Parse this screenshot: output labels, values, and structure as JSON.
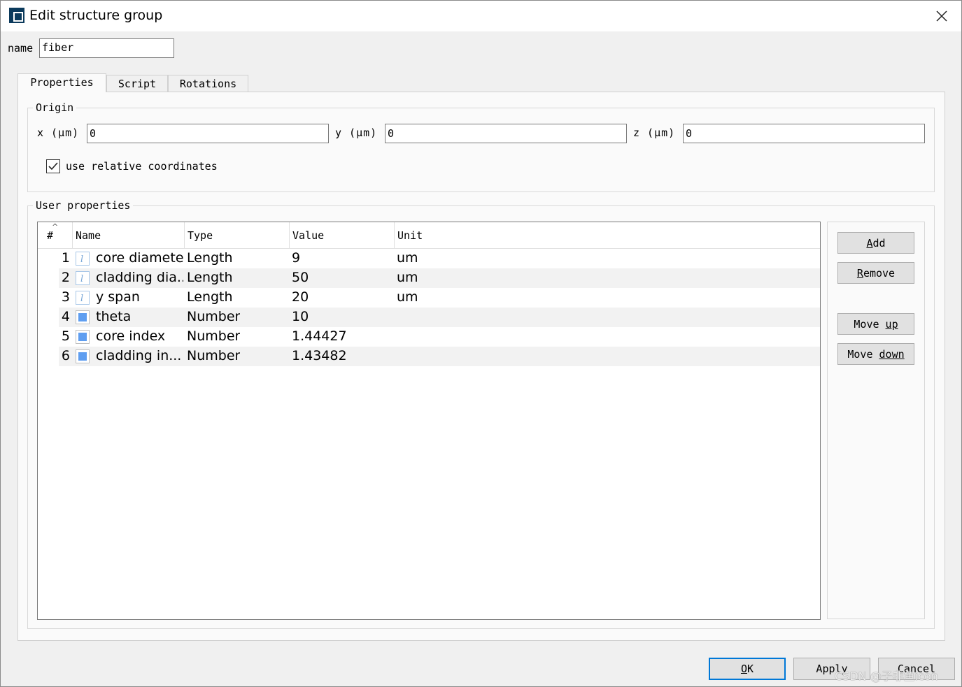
{
  "window": {
    "title": "Edit structure group",
    "close_icon": "close-icon",
    "app_icon": "app-icon"
  },
  "name_field": {
    "label": "name",
    "value": "fiber"
  },
  "tabs": [
    {
      "label": "Properties",
      "active": true
    },
    {
      "label": "Script",
      "active": false
    },
    {
      "label": "Rotations",
      "active": false
    }
  ],
  "origin": {
    "title": "Origin",
    "x_label": "x (μm)",
    "x_value": "0",
    "y_label": "y (μm)",
    "y_value": "0",
    "z_label": "z (μm)",
    "z_value": "0",
    "relative_label": "use relative coordinates",
    "relative_checked": true
  },
  "user_properties": {
    "title": "User properties",
    "columns": [
      "#",
      "Name",
      "Type",
      "Value",
      "Unit"
    ],
    "rows": [
      {
        "num": "1",
        "icon": "length-icon",
        "name": "core diameter",
        "type": "Length",
        "value": "9",
        "unit": "um"
      },
      {
        "num": "2",
        "icon": "length-icon",
        "name": "cladding dia...",
        "type": "Length",
        "value": "50",
        "unit": "um"
      },
      {
        "num": "3",
        "icon": "length-icon",
        "name": "y span",
        "type": "Length",
        "value": "20",
        "unit": "um"
      },
      {
        "num": "4",
        "icon": "number-icon",
        "name": "theta",
        "type": "Number",
        "value": "10",
        "unit": ""
      },
      {
        "num": "5",
        "icon": "number-icon",
        "name": "core index",
        "type": "Number",
        "value": "1.44427",
        "unit": ""
      },
      {
        "num": "6",
        "icon": "number-icon",
        "name": "cladding in...",
        "type": "Number",
        "value": "1.43482",
        "unit": ""
      }
    ],
    "buttons": {
      "add": {
        "pre": "",
        "key": "A",
        "post": "dd"
      },
      "remove": {
        "pre": "",
        "key": "R",
        "post": "emove"
      },
      "move_up": {
        "pre": "Move ",
        "key": "up",
        "post": ""
      },
      "move_down": {
        "pre": "Move ",
        "key": "down",
        "post": ""
      }
    }
  },
  "footer": {
    "ok": {
      "pre": "",
      "key": "O",
      "post": "K"
    },
    "apply": {
      "pre": "Apply",
      "key": "",
      "post": ""
    },
    "cancel": {
      "pre": "Cancel",
      "key": "",
      "post": ""
    }
  },
  "watermark": "CSDN @子非鱼icon",
  "colors": {
    "accent": "#0078d7",
    "title_icon": "#0b3a5c",
    "number_icon": "#5f9ef0",
    "row_alt": "#f2f2f2"
  }
}
